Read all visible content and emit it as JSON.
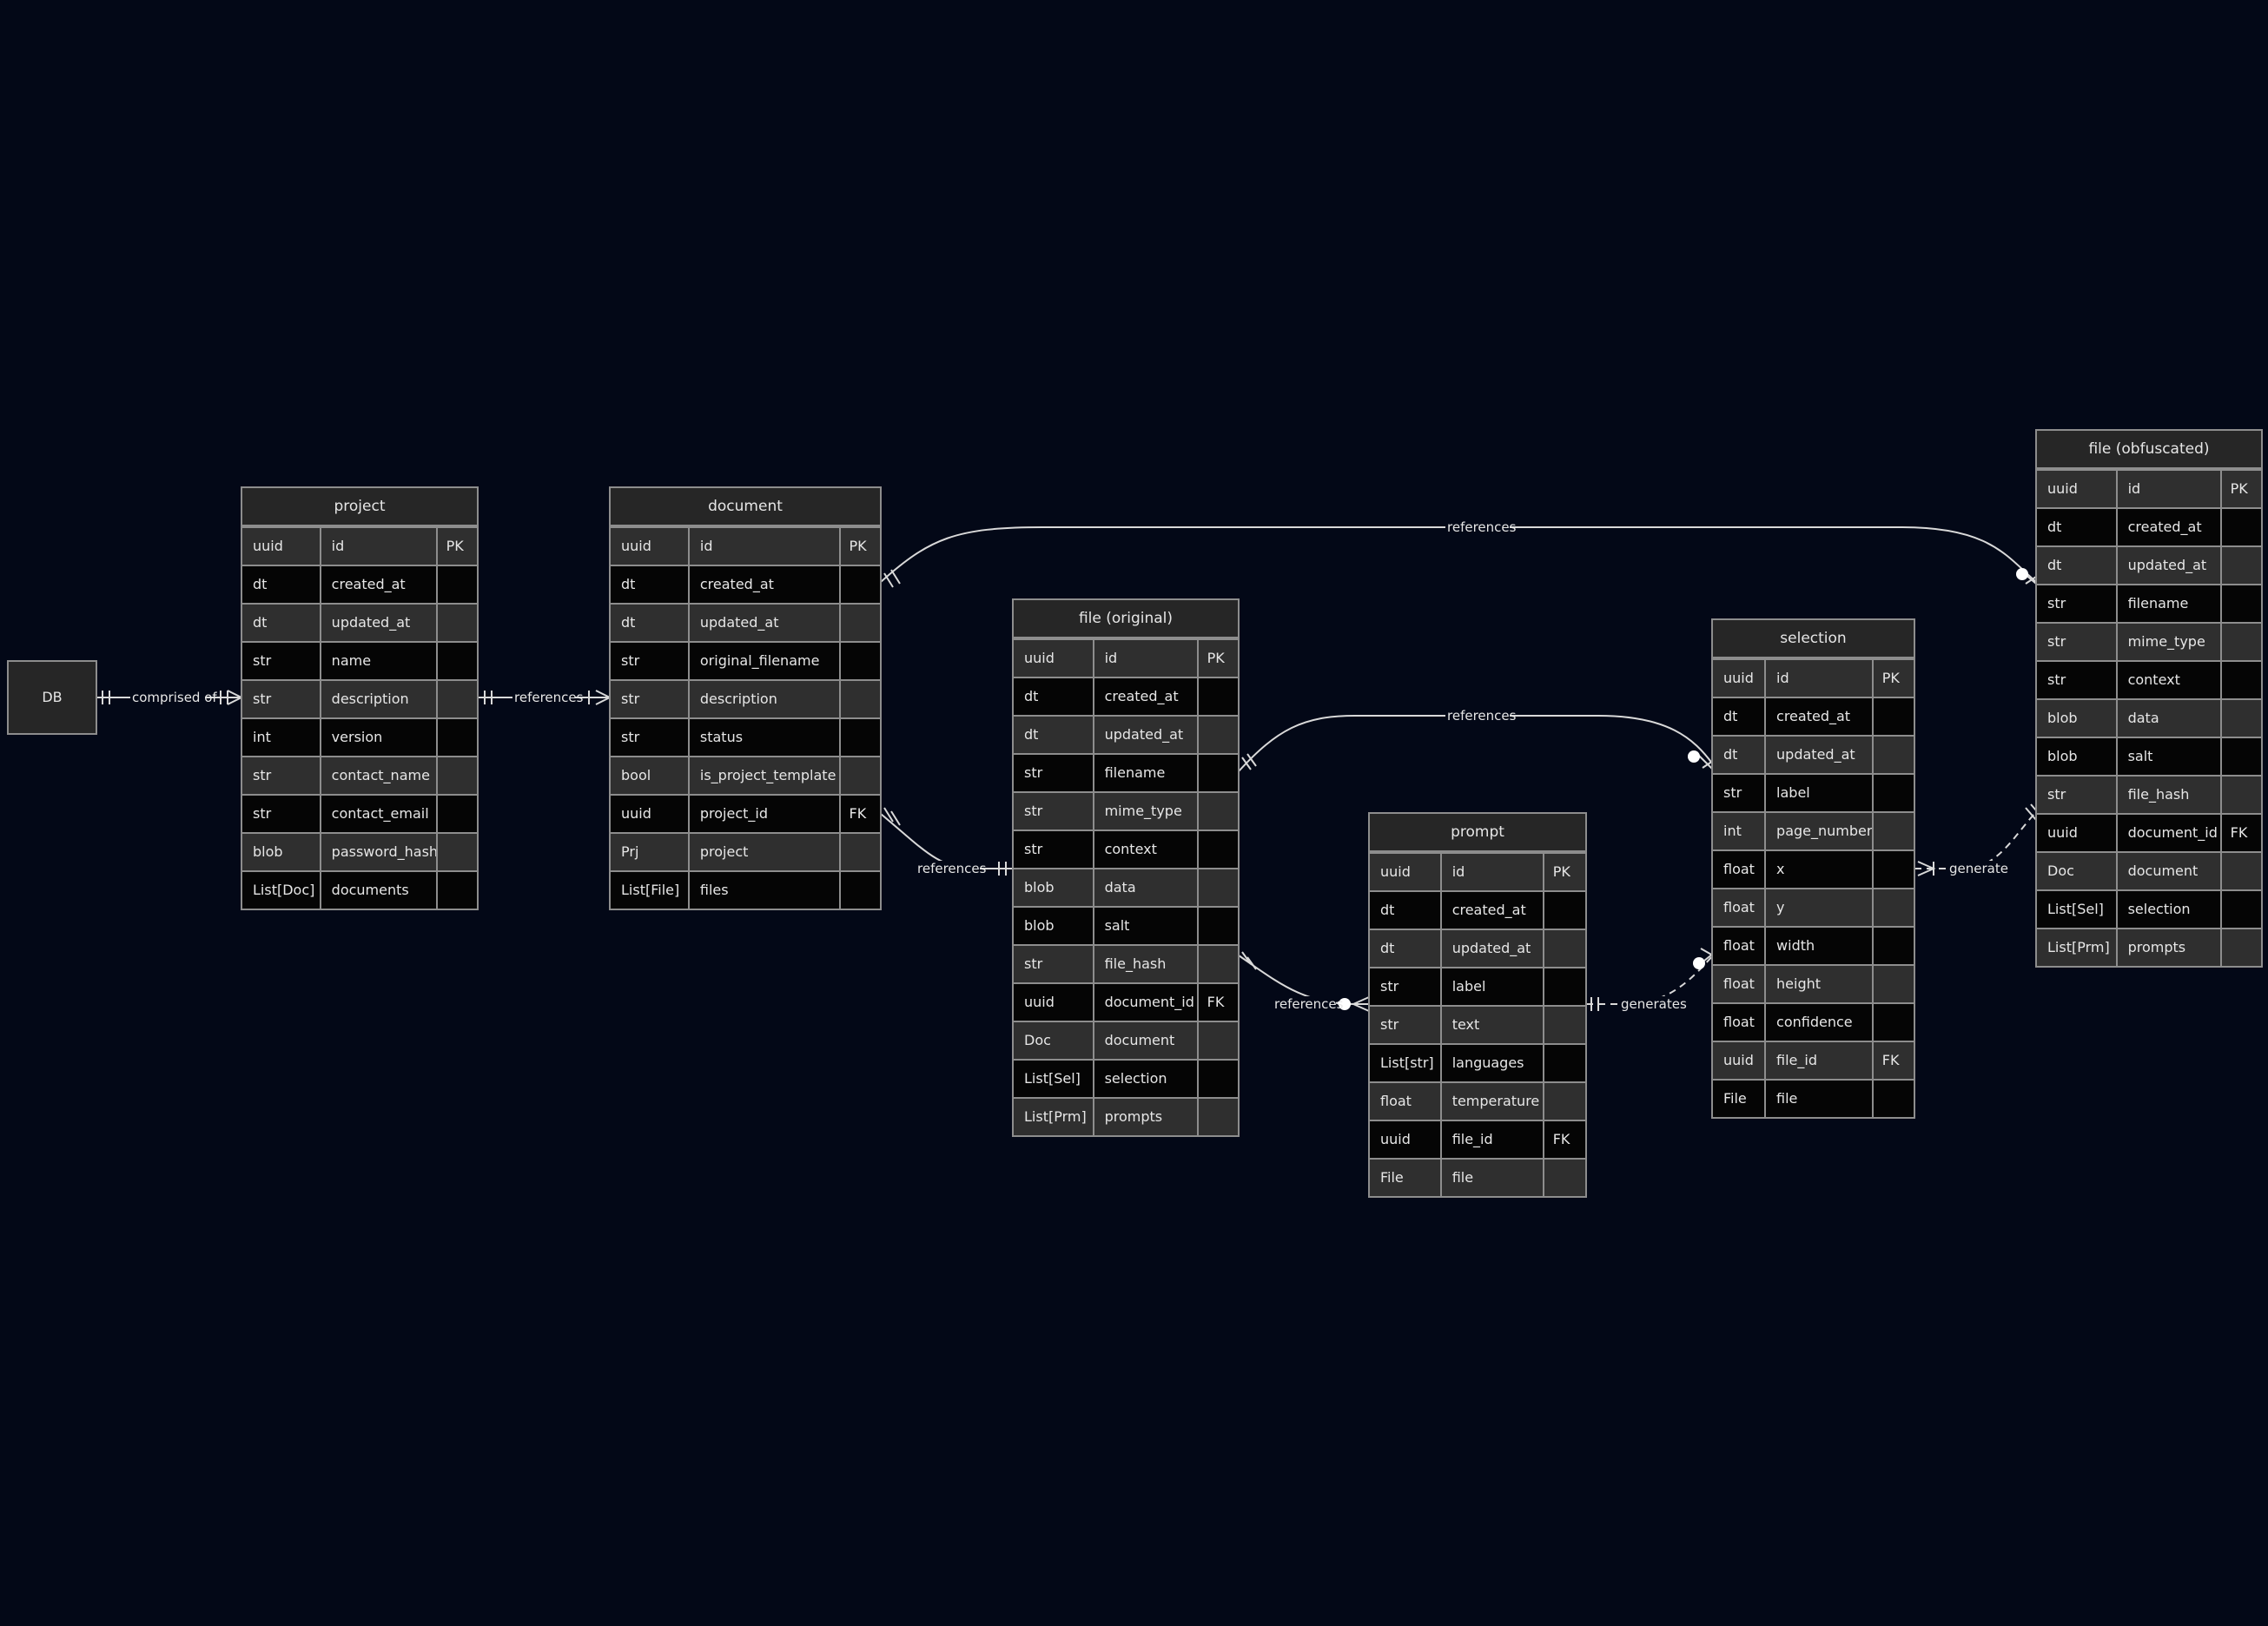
{
  "db_node": {
    "label": "DB"
  },
  "relationship_labels": {
    "db_project": "comprised of",
    "project_document": "references",
    "document_file_obfuscated": "references",
    "document_file_original": "references",
    "file_original_selection": "references",
    "file_original_prompt": "references",
    "selection_prompt": "generates",
    "selection_file_obfuscated": "generate"
  },
  "entities": {
    "project": {
      "title": "project",
      "rows": [
        {
          "type": "uuid",
          "name": "id",
          "key": "PK"
        },
        {
          "type": "dt",
          "name": "created_at",
          "key": ""
        },
        {
          "type": "dt",
          "name": "updated_at",
          "key": ""
        },
        {
          "type": "str",
          "name": "name",
          "key": ""
        },
        {
          "type": "str",
          "name": "description",
          "key": ""
        },
        {
          "type": "int",
          "name": "version",
          "key": ""
        },
        {
          "type": "str",
          "name": "contact_name",
          "key": ""
        },
        {
          "type": "str",
          "name": "contact_email",
          "key": ""
        },
        {
          "type": "blob",
          "name": "password_hash",
          "key": ""
        },
        {
          "type": "List[Doc]",
          "name": "documents",
          "key": ""
        }
      ]
    },
    "document": {
      "title": "document",
      "rows": [
        {
          "type": "uuid",
          "name": "id",
          "key": "PK"
        },
        {
          "type": "dt",
          "name": "created_at",
          "key": ""
        },
        {
          "type": "dt",
          "name": "updated_at",
          "key": ""
        },
        {
          "type": "str",
          "name": "original_filename",
          "key": ""
        },
        {
          "type": "str",
          "name": "description",
          "key": ""
        },
        {
          "type": "str",
          "name": "status",
          "key": ""
        },
        {
          "type": "bool",
          "name": "is_project_template",
          "key": ""
        },
        {
          "type": "uuid",
          "name": "project_id",
          "key": "FK"
        },
        {
          "type": "Prj",
          "name": "project",
          "key": ""
        },
        {
          "type": "List[File]",
          "name": "files",
          "key": ""
        }
      ]
    },
    "file_original": {
      "title": "file (original)",
      "rows": [
        {
          "type": "uuid",
          "name": "id",
          "key": "PK"
        },
        {
          "type": "dt",
          "name": "created_at",
          "key": ""
        },
        {
          "type": "dt",
          "name": "updated_at",
          "key": ""
        },
        {
          "type": "str",
          "name": "filename",
          "key": ""
        },
        {
          "type": "str",
          "name": "mime_type",
          "key": ""
        },
        {
          "type": "str",
          "name": "context",
          "key": ""
        },
        {
          "type": "blob",
          "name": "data",
          "key": ""
        },
        {
          "type": "blob",
          "name": "salt",
          "key": ""
        },
        {
          "type": "str",
          "name": "file_hash",
          "key": ""
        },
        {
          "type": "uuid",
          "name": "document_id",
          "key": "FK"
        },
        {
          "type": "Doc",
          "name": "document",
          "key": ""
        },
        {
          "type": "List[Sel]",
          "name": "selection",
          "key": ""
        },
        {
          "type": "List[Prm]",
          "name": "prompts",
          "key": ""
        }
      ]
    },
    "prompt": {
      "title": "prompt",
      "rows": [
        {
          "type": "uuid",
          "name": "id",
          "key": "PK"
        },
        {
          "type": "dt",
          "name": "created_at",
          "key": ""
        },
        {
          "type": "dt",
          "name": "updated_at",
          "key": ""
        },
        {
          "type": "str",
          "name": "label",
          "key": ""
        },
        {
          "type": "str",
          "name": "text",
          "key": ""
        },
        {
          "type": "List[str]",
          "name": "languages",
          "key": ""
        },
        {
          "type": "float",
          "name": "temperature",
          "key": ""
        },
        {
          "type": "uuid",
          "name": "file_id",
          "key": "FK"
        },
        {
          "type": "File",
          "name": "file",
          "key": ""
        }
      ]
    },
    "selection": {
      "title": "selection",
      "rows": [
        {
          "type": "uuid",
          "name": "id",
          "key": "PK"
        },
        {
          "type": "dt",
          "name": "created_at",
          "key": ""
        },
        {
          "type": "dt",
          "name": "updated_at",
          "key": ""
        },
        {
          "type": "str",
          "name": "label",
          "key": ""
        },
        {
          "type": "int",
          "name": "page_number",
          "key": ""
        },
        {
          "type": "float",
          "name": "x",
          "key": ""
        },
        {
          "type": "float",
          "name": "y",
          "key": ""
        },
        {
          "type": "float",
          "name": "width",
          "key": ""
        },
        {
          "type": "float",
          "name": "height",
          "key": ""
        },
        {
          "type": "float",
          "name": "confidence",
          "key": ""
        },
        {
          "type": "uuid",
          "name": "file_id",
          "key": "FK"
        },
        {
          "type": "File",
          "name": "file",
          "key": ""
        }
      ]
    },
    "file_obfuscated": {
      "title": "file (obfuscated)",
      "rows": [
        {
          "type": "uuid",
          "name": "id",
          "key": "PK"
        },
        {
          "type": "dt",
          "name": "created_at",
          "key": ""
        },
        {
          "type": "dt",
          "name": "updated_at",
          "key": ""
        },
        {
          "type": "str",
          "name": "filename",
          "key": ""
        },
        {
          "type": "str",
          "name": "mime_type",
          "key": ""
        },
        {
          "type": "str",
          "name": "context",
          "key": ""
        },
        {
          "type": "blob",
          "name": "data",
          "key": ""
        },
        {
          "type": "blob",
          "name": "salt",
          "key": ""
        },
        {
          "type": "str",
          "name": "file_hash",
          "key": ""
        },
        {
          "type": "uuid",
          "name": "document_id",
          "key": "FK"
        },
        {
          "type": "Doc",
          "name": "document",
          "key": ""
        },
        {
          "type": "List[Sel]",
          "name": "selection",
          "key": ""
        },
        {
          "type": "List[Prm]",
          "name": "prompts",
          "key": ""
        }
      ]
    }
  }
}
